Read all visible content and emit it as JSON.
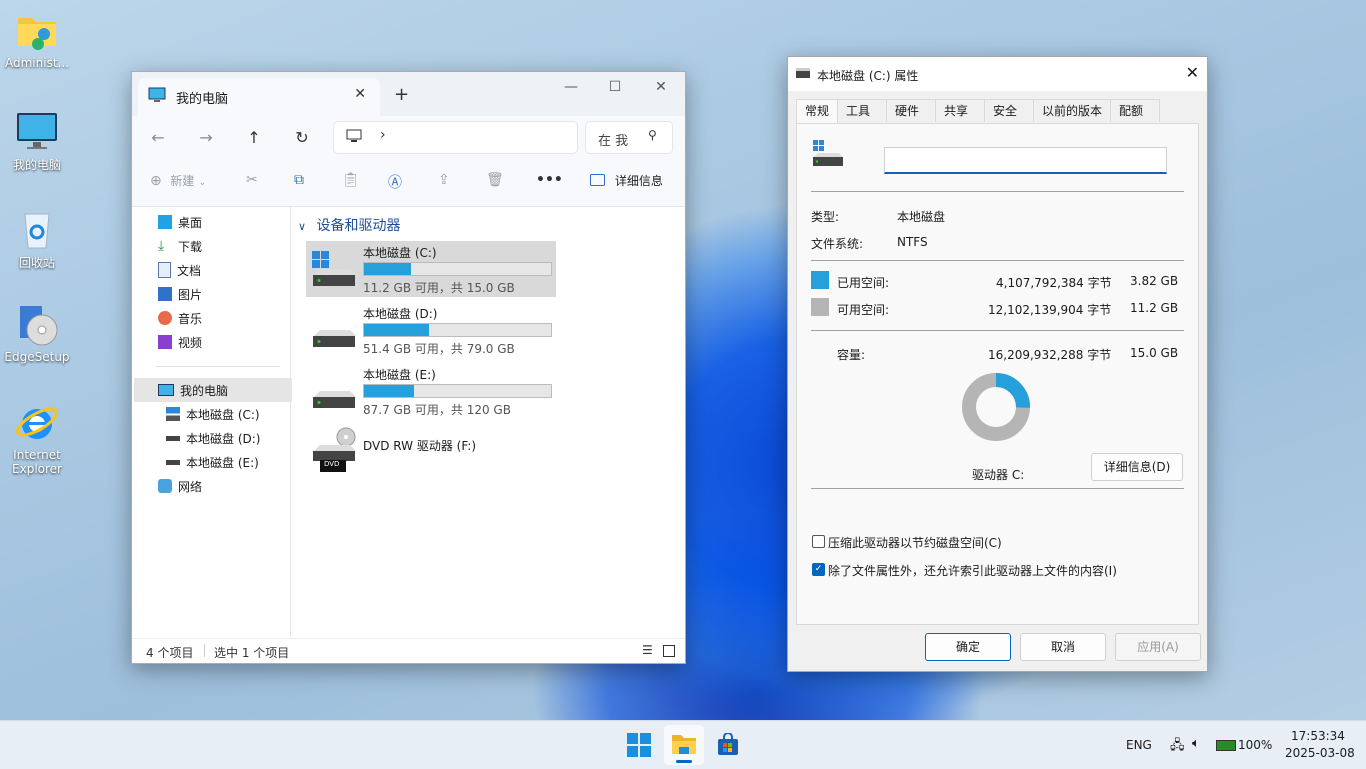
{
  "desktop": {
    "icons": [
      {
        "label": "Administ..."
      },
      {
        "label": "我的电脑"
      },
      {
        "label": "回收站"
      },
      {
        "label": "EdgeSetup"
      },
      {
        "label": "Internet Explorer"
      }
    ]
  },
  "explorer": {
    "tab_title": "我的电脑",
    "new_tab": "+",
    "search_placeholder": "在 我",
    "toolbar": {
      "new_label": "新建",
      "more": "•••",
      "details_label": "详细信息"
    },
    "sidebar": {
      "quick": [
        {
          "label": "桌面"
        },
        {
          "label": "下载"
        },
        {
          "label": "文档"
        },
        {
          "label": "图片"
        },
        {
          "label": "音乐"
        },
        {
          "label": "视频"
        }
      ],
      "this_pc": "我的电脑",
      "drives": [
        {
          "label": "本地磁盘 (C:)"
        },
        {
          "label": "本地磁盘 (D:)"
        },
        {
          "label": "本地磁盘 (E:)"
        }
      ],
      "network": "网络"
    },
    "section_title": "设备和驱动器",
    "drives": [
      {
        "name": "本地磁盘 (C:)",
        "info": "11.2 GB 可用，共 15.0 GB",
        "used_fraction": 0.25
      },
      {
        "name": "本地磁盘 (D:)",
        "info": "51.4 GB 可用，共 79.0 GB",
        "used_fraction": 0.35
      },
      {
        "name": "本地磁盘 (E:)",
        "info": "87.7 GB 可用，共 120 GB",
        "used_fraction": 0.27
      },
      {
        "name": "DVD RW 驱动器 (F:)",
        "badge": "DVD"
      }
    ],
    "status": {
      "count": "4 个项目",
      "selected": "选中 1 个项目"
    }
  },
  "properties": {
    "title": "本地磁盘 (C:) 属性",
    "tabs": [
      "常规",
      "工具",
      "硬件",
      "共享",
      "安全",
      "以前的版本",
      "配额"
    ],
    "name_value": "",
    "type_label": "类型:",
    "type_value": "本地磁盘",
    "fs_label": "文件系统:",
    "fs_value": "NTFS",
    "used_label": "已用空间:",
    "used_bytes": "4,107,792,384 字节",
    "used_size": "3.82 GB",
    "free_label": "可用空间:",
    "free_bytes": "12,102,139,904 字节",
    "free_size": "11.2 GB",
    "cap_label": "容量:",
    "cap_bytes": "16,209,932,288 字节",
    "cap_size": "15.0 GB",
    "used_fraction": 0.253,
    "drive_label": "驱动器 C:",
    "details_button": "详细信息(D)",
    "compress_label": "压缩此驱动器以节约磁盘空间(C)",
    "compress_checked": false,
    "index_label": "除了文件属性外，还允许索引此驱动器上文件的内容(I)",
    "index_checked": true,
    "ok": "确定",
    "cancel": "取消",
    "apply": "应用(A)",
    "colors": {
      "used": "#26a0da",
      "free": "#b5b5b5"
    }
  },
  "taskbar": {
    "lang": "ENG",
    "battery": "100%",
    "time": "17:53:34",
    "date": "2025-03-08"
  }
}
